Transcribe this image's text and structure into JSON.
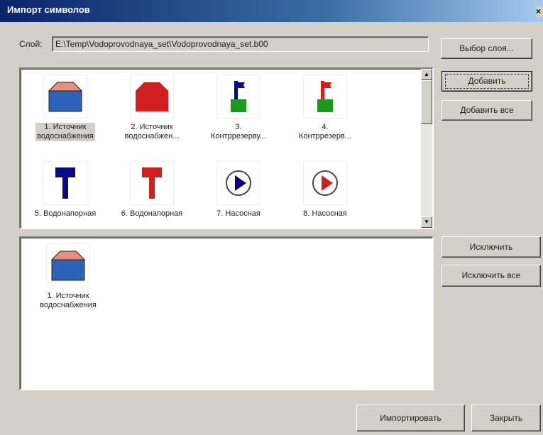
{
  "window": {
    "title": "Импорт символов",
    "close_glyph": "×"
  },
  "layer": {
    "label": "Слой:",
    "path": "E:\\Temp\\Vodoprovodnaya_set\\Vodoprovodnaya_set.b00",
    "choose_button": "Выбор слоя..."
  },
  "available": {
    "items": [
      {
        "caption": "1. Источник\nводоснабжения",
        "icon": "water-source-blue-icon",
        "selected": true
      },
      {
        "caption": "2. Источник\nводоснабжен...",
        "icon": "water-source-red-icon",
        "selected": false
      },
      {
        "caption": "3.\nКонтррезерву...",
        "icon": "counter-reservoir-blue-icon",
        "selected": false
      },
      {
        "caption": "4.\nКонтррезерв...",
        "icon": "counter-reservoir-red-icon",
        "selected": false
      },
      {
        "caption": "5. Водонапорная",
        "icon": "water-tower-blue-icon",
        "selected": false
      },
      {
        "caption": "6. Водонапорная",
        "icon": "water-tower-red-icon",
        "selected": false
      },
      {
        "caption": "7. Насосная",
        "icon": "pump-station-blue-icon",
        "selected": false
      },
      {
        "caption": "8. Насосная",
        "icon": "pump-station-red-icon",
        "selected": false
      }
    ]
  },
  "selected": {
    "items": [
      {
        "caption": "1. Источник\nводоснабжения",
        "icon": "water-source-blue-icon"
      }
    ]
  },
  "buttons": {
    "add": "Добавить",
    "add_all": "Добавить все",
    "exclude": "Исключить",
    "exclude_all": "Исключить все",
    "import": "Импортировать",
    "close": "Закрыть"
  },
  "colors": {
    "blue": "#2e62b8",
    "navy": "#0a0a80",
    "red": "#d01f1f",
    "green": "#1a9a1a",
    "salmon": "#e8907a"
  }
}
